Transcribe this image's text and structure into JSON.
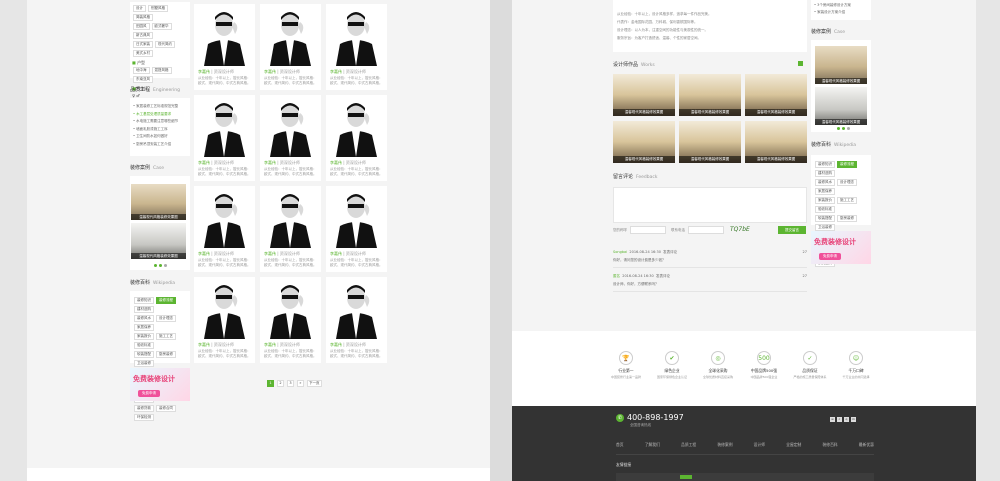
{
  "left": {
    "tags_top": [
      [
        "设计",
        "别墅风格",
        "简装风格"
      ],
      [
        "田园风",
        "欧式奢华",
        "新古典风"
      ],
      [
        "日式家装",
        "现代简约",
        "美式乡村"
      ],
      [
        "地中海",
        "混搭风格",
        "东南亚风"
      ]
    ],
    "section_huxing": "户型",
    "section_gender": "性别",
    "gender_symbols": "♀ ♂",
    "eng_title": "品质工程",
    "eng_sub": "Engineering",
    "eng_items": [
      "家居装修工艺标准规范完整",
      "木工基层处理质量要求",
      "水电施工需要注意哪些细节",
      "墙面乳胶漆施工工序",
      "卫生间防水如何做好",
      "厨房吊顶安装工艺介绍"
    ],
    "case_title": "装修案例",
    "case_sub": "Case",
    "case_caption": "温馨现代风格装修效果图",
    "wiki_title": "装修百科",
    "wiki_sub": "Wikipedia",
    "wiki_tags": [
      [
        "装修知识",
        "装修流程",
        "建材选购"
      ],
      [
        "装修风水",
        "设计理念",
        "家居保养"
      ],
      [
        "家装报价",
        "施工工艺",
        "验收标准"
      ],
      [
        "软装搭配",
        "厨房装修",
        "卫浴装修"
      ],
      [
        "灯具选购",
        "地板选购",
        "瓷砖选购"
      ],
      [
        "墙纸选购",
        "门窗选购",
        "家具选购"
      ],
      [
        "装修贷款",
        "装修合同",
        "环保检测"
      ]
    ],
    "banner_text": "免费装修设计",
    "banner_btn": "免费申请",
    "designer_name": "李嘉伟",
    "designer_role": "资深设计师",
    "designer_desc": "从业经验：十年以上，擅长风格：欧式、现代简约、中式古典风格。",
    "pager": [
      "1",
      "2",
      "3",
      "»",
      "下一页"
    ]
  },
  "right": {
    "intro_lines": [
      "从业经验：十年以上，设计风格多样，追求每一件作品完美。",
      "代表作：金地国际花园、万科城、保利香槟国际等。",
      "设计理念：以人为本，注重空间的功能性与美观性的统一。",
      "服务宗旨：为客户打造舒适、温馨、个性的家居空间。"
    ],
    "works_title": "设计师作品",
    "works_sub": "Works",
    "work_caption": "温馨现代风格装修效果图",
    "feedback_title": "留言评论",
    "feedback_sub": "Feedback",
    "form_name_label": "您的称呼",
    "form_phone_label": "联系电话",
    "captcha": "TQ7bE",
    "submit_label": "提交留言",
    "comments": [
      {
        "user": "Songbai",
        "time": "2016-08-24 16:30",
        "tag": "发表评论",
        "text": "你好，请问您的设计费是多少钱？",
        "num": "27"
      },
      {
        "user": "匿名",
        "time": "2016-08-24 16:30",
        "tag": "发表评论",
        "text": "设计师，你好，方便联系吗？",
        "num": "27"
      }
    ],
    "side_items": [
      "3个房间装修设计方案",
      "家装设计方案介绍"
    ],
    "side_case_title": "装修案例",
    "side_case_sub": "Case",
    "side_wiki_title": "装修百科",
    "side_wiki_sub": "Wikipedia",
    "services": [
      {
        "icon": "🏆",
        "title": "行业第一",
        "desc": "中国装修行业第一品牌"
      },
      {
        "icon": "✔",
        "title": "绿色企业",
        "desc": "国家环保绿色企业认证"
      },
      {
        "icon": "◎",
        "title": "全球化采购",
        "desc": "全球优质材料直接采购"
      },
      {
        "icon": "500",
        "title": "中国品牌500强",
        "desc": "中国品牌500强企业"
      },
      {
        "icon": "✓",
        "title": "品质保证",
        "desc": "严格的施工质量保障体系"
      },
      {
        "icon": "☺",
        "title": "千万口碑",
        "desc": "千万业主的共同选择"
      }
    ],
    "phone": "400-898-1997",
    "phone_sub": "全国咨询热线",
    "footer_nav": [
      "首页",
      "了解我们",
      "品质工程",
      "装修案例",
      "设计师",
      "全屋定制",
      "装修百科",
      "最新优惠"
    ],
    "flink_title": "友情链接"
  }
}
